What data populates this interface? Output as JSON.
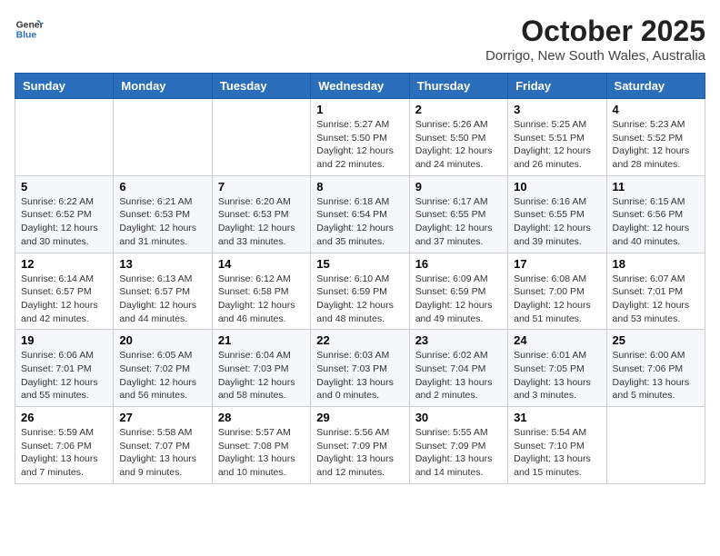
{
  "header": {
    "logo_line1": "General",
    "logo_line2": "Blue",
    "month": "October 2025",
    "location": "Dorrigo, New South Wales, Australia"
  },
  "weekdays": [
    "Sunday",
    "Monday",
    "Tuesday",
    "Wednesday",
    "Thursday",
    "Friday",
    "Saturday"
  ],
  "weeks": [
    [
      {
        "day": "",
        "info": ""
      },
      {
        "day": "",
        "info": ""
      },
      {
        "day": "",
        "info": ""
      },
      {
        "day": "1",
        "info": "Sunrise: 5:27 AM\nSunset: 5:50 PM\nDaylight: 12 hours\nand 22 minutes."
      },
      {
        "day": "2",
        "info": "Sunrise: 5:26 AM\nSunset: 5:50 PM\nDaylight: 12 hours\nand 24 minutes."
      },
      {
        "day": "3",
        "info": "Sunrise: 5:25 AM\nSunset: 5:51 PM\nDaylight: 12 hours\nand 26 minutes."
      },
      {
        "day": "4",
        "info": "Sunrise: 5:23 AM\nSunset: 5:52 PM\nDaylight: 12 hours\nand 28 minutes."
      }
    ],
    [
      {
        "day": "5",
        "info": "Sunrise: 6:22 AM\nSunset: 6:52 PM\nDaylight: 12 hours\nand 30 minutes."
      },
      {
        "day": "6",
        "info": "Sunrise: 6:21 AM\nSunset: 6:53 PM\nDaylight: 12 hours\nand 31 minutes."
      },
      {
        "day": "7",
        "info": "Sunrise: 6:20 AM\nSunset: 6:53 PM\nDaylight: 12 hours\nand 33 minutes."
      },
      {
        "day": "8",
        "info": "Sunrise: 6:18 AM\nSunset: 6:54 PM\nDaylight: 12 hours\nand 35 minutes."
      },
      {
        "day": "9",
        "info": "Sunrise: 6:17 AM\nSunset: 6:55 PM\nDaylight: 12 hours\nand 37 minutes."
      },
      {
        "day": "10",
        "info": "Sunrise: 6:16 AM\nSunset: 6:55 PM\nDaylight: 12 hours\nand 39 minutes."
      },
      {
        "day": "11",
        "info": "Sunrise: 6:15 AM\nSunset: 6:56 PM\nDaylight: 12 hours\nand 40 minutes."
      }
    ],
    [
      {
        "day": "12",
        "info": "Sunrise: 6:14 AM\nSunset: 6:57 PM\nDaylight: 12 hours\nand 42 minutes."
      },
      {
        "day": "13",
        "info": "Sunrise: 6:13 AM\nSunset: 6:57 PM\nDaylight: 12 hours\nand 44 minutes."
      },
      {
        "day": "14",
        "info": "Sunrise: 6:12 AM\nSunset: 6:58 PM\nDaylight: 12 hours\nand 46 minutes."
      },
      {
        "day": "15",
        "info": "Sunrise: 6:10 AM\nSunset: 6:59 PM\nDaylight: 12 hours\nand 48 minutes."
      },
      {
        "day": "16",
        "info": "Sunrise: 6:09 AM\nSunset: 6:59 PM\nDaylight: 12 hours\nand 49 minutes."
      },
      {
        "day": "17",
        "info": "Sunrise: 6:08 AM\nSunset: 7:00 PM\nDaylight: 12 hours\nand 51 minutes."
      },
      {
        "day": "18",
        "info": "Sunrise: 6:07 AM\nSunset: 7:01 PM\nDaylight: 12 hours\nand 53 minutes."
      }
    ],
    [
      {
        "day": "19",
        "info": "Sunrise: 6:06 AM\nSunset: 7:01 PM\nDaylight: 12 hours\nand 55 minutes."
      },
      {
        "day": "20",
        "info": "Sunrise: 6:05 AM\nSunset: 7:02 PM\nDaylight: 12 hours\nand 56 minutes."
      },
      {
        "day": "21",
        "info": "Sunrise: 6:04 AM\nSunset: 7:03 PM\nDaylight: 12 hours\nand 58 minutes."
      },
      {
        "day": "22",
        "info": "Sunrise: 6:03 AM\nSunset: 7:03 PM\nDaylight: 13 hours\nand 0 minutes."
      },
      {
        "day": "23",
        "info": "Sunrise: 6:02 AM\nSunset: 7:04 PM\nDaylight: 13 hours\nand 2 minutes."
      },
      {
        "day": "24",
        "info": "Sunrise: 6:01 AM\nSunset: 7:05 PM\nDaylight: 13 hours\nand 3 minutes."
      },
      {
        "day": "25",
        "info": "Sunrise: 6:00 AM\nSunset: 7:06 PM\nDaylight: 13 hours\nand 5 minutes."
      }
    ],
    [
      {
        "day": "26",
        "info": "Sunrise: 5:59 AM\nSunset: 7:06 PM\nDaylight: 13 hours\nand 7 minutes."
      },
      {
        "day": "27",
        "info": "Sunrise: 5:58 AM\nSunset: 7:07 PM\nDaylight: 13 hours\nand 9 minutes."
      },
      {
        "day": "28",
        "info": "Sunrise: 5:57 AM\nSunset: 7:08 PM\nDaylight: 13 hours\nand 10 minutes."
      },
      {
        "day": "29",
        "info": "Sunrise: 5:56 AM\nSunset: 7:09 PM\nDaylight: 13 hours\nand 12 minutes."
      },
      {
        "day": "30",
        "info": "Sunrise: 5:55 AM\nSunset: 7:09 PM\nDaylight: 13 hours\nand 14 minutes."
      },
      {
        "day": "31",
        "info": "Sunrise: 5:54 AM\nSunset: 7:10 PM\nDaylight: 13 hours\nand 15 minutes."
      },
      {
        "day": "",
        "info": ""
      }
    ]
  ]
}
